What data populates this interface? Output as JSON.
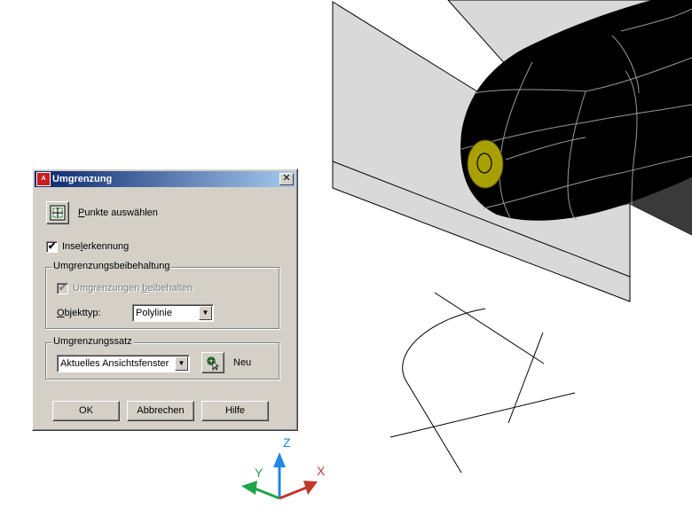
{
  "dialog": {
    "title": "Umgrenzung",
    "pick_points_pre": "",
    "pick_points_ul": "P",
    "pick_points_post": "unkte auswählen",
    "island_pre": "Inse",
    "island_ul": "l",
    "island_post": "erkennung",
    "island_checked": "✔",
    "retention_title": "Umgrenzungsbeibehaltung",
    "retain_pre": "Umgrenzungen ",
    "retain_ul": "b",
    "retain_post": "eibehalten",
    "retain_checked": "✔",
    "objtype_pre": "",
    "objtype_ul": "O",
    "objtype_post": "bjekttyp:",
    "objtype_value": "Polylinie",
    "set_title": "Umgrenzungssatz",
    "set_value": "Aktuelles Ansichtsfenster",
    "new_label": "Neu",
    "ok_label": "OK",
    "cancel_label": "Abbrechen",
    "help_label": "Hilfe",
    "close_glyph": "✕",
    "dropdown_glyph": "▼"
  },
  "ucs": {
    "x_label": "X",
    "y_label": "Y",
    "z_label": "Z",
    "x_color": "#c0392b",
    "y_color": "#1fa34a",
    "z_color": "#1e88e5"
  },
  "colors": {
    "titlebar_start": "#0a246a",
    "titlebar_end": "#a6caf0",
    "dialog_bg": "#d4d0c8",
    "model_fill": "#000000",
    "hole_fill": "#a8a000"
  }
}
